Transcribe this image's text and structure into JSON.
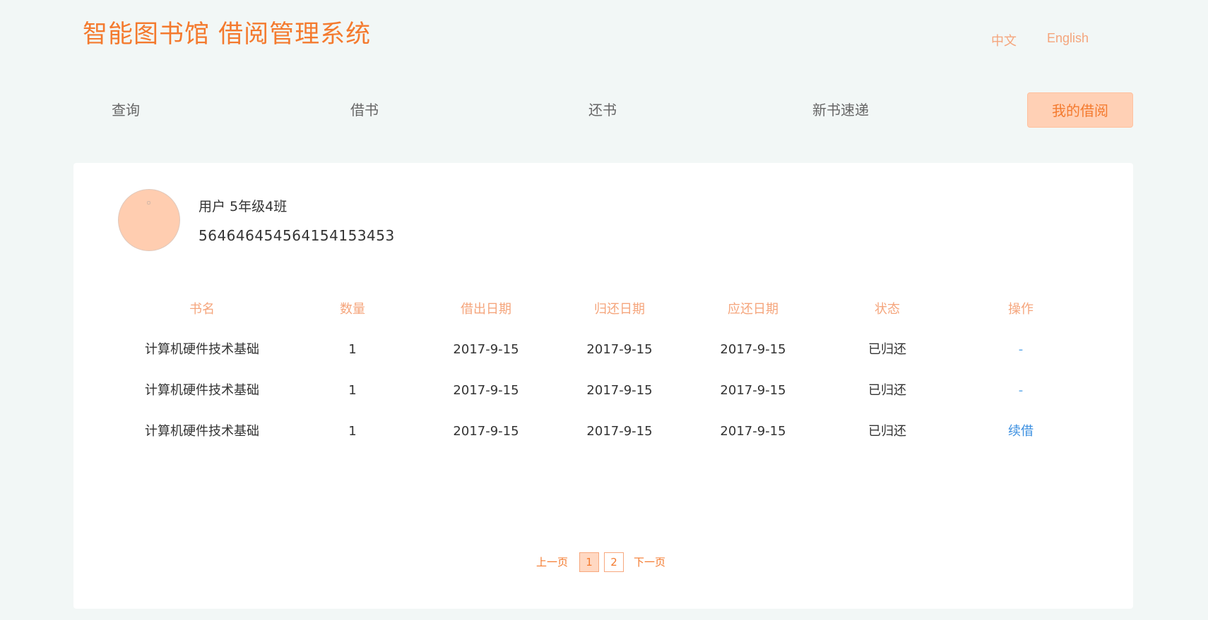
{
  "header": {
    "logo_text": "智能图书馆 借阅管理系统",
    "lang_zh": "中文",
    "lang_en": "English"
  },
  "nav": {
    "items": [
      {
        "label": "查询"
      },
      {
        "label": "借书"
      },
      {
        "label": "还书"
      },
      {
        "label": "新书速递"
      },
      {
        "label": "我的借阅"
      }
    ],
    "active": "我的借阅"
  },
  "user": {
    "name_line": "用户 5年级4班",
    "card_number": "564646454564154153453"
  },
  "table": {
    "headers": [
      "书名",
      "数量",
      "借出日期",
      "归还日期",
      "应还日期",
      "状态",
      "操作"
    ],
    "rows": [
      {
        "title": "计算机硬件技术基础",
        "qty": "1",
        "borrow_date": "2017-9-15",
        "return_date": "2017-9-15",
        "due_date": "2017-9-15",
        "status": "已归还",
        "action": "-"
      },
      {
        "title": "计算机硬件技术基础",
        "qty": "1",
        "borrow_date": "2017-9-15",
        "return_date": "2017-9-15",
        "due_date": "2017-9-15",
        "status": "已归还",
        "action": "-"
      },
      {
        "title": "计算机硬件技术基础",
        "qty": "1",
        "borrow_date": "2017-9-15",
        "return_date": "2017-9-15",
        "due_date": "2017-9-15",
        "status": "已归还",
        "action": "续借"
      }
    ]
  },
  "pagination": {
    "prev": "上一页",
    "pages": [
      "1",
      "2"
    ],
    "current": "1",
    "next": "下一页"
  },
  "colors": {
    "accent": "#f47a2e",
    "accent_light": "#ffd0b5",
    "link": "#3b8fe0",
    "background": "#f2f7f6"
  }
}
